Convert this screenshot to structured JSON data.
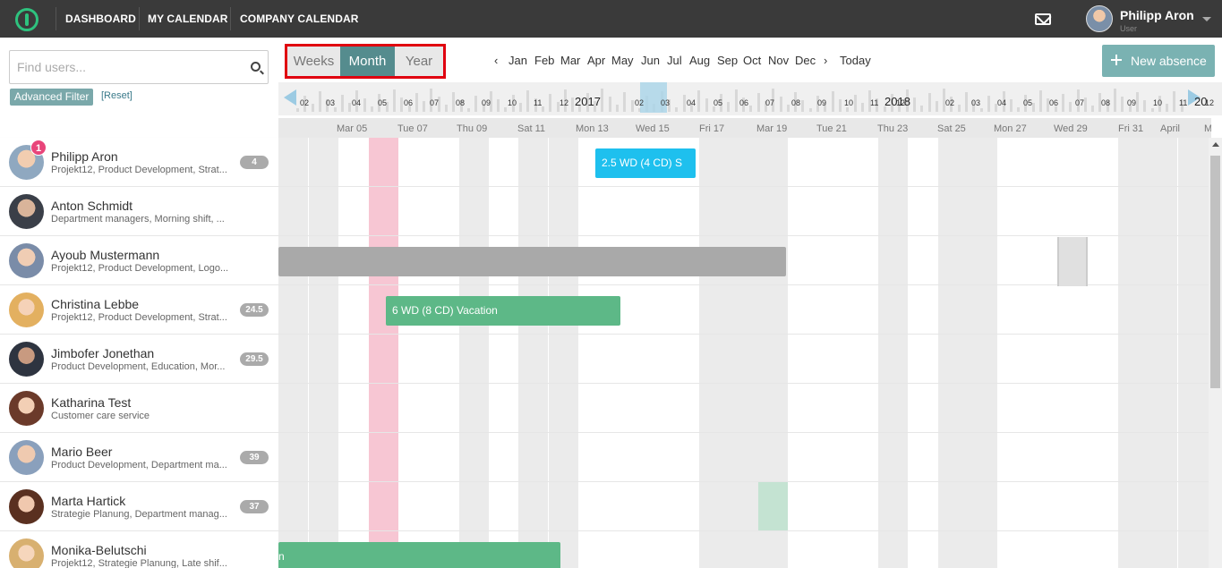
{
  "nav": {
    "items": [
      "DASHBOARD",
      "MY CALENDAR",
      "COMPANY CALENDAR"
    ],
    "user_name": "Philipp Aron",
    "user_role": "User"
  },
  "search": {
    "placeholder": "Find users..."
  },
  "filters": {
    "advanced_label": "Advanced Filter",
    "reset_label": "[Reset]"
  },
  "toolbar": {
    "views": [
      "Weeks",
      "Month",
      "Year"
    ],
    "active_view": "Month",
    "prev": "‹",
    "next": "›",
    "months": [
      "Jan",
      "Feb",
      "Mar",
      "Apr",
      "May",
      "Jun",
      "Jul",
      "Aug",
      "Sep",
      "Oct",
      "Nov",
      "Dec"
    ],
    "today": "Today",
    "new_absence": "New absence"
  },
  "timeline": {
    "years": [
      "2017",
      "2018",
      "20"
    ],
    "labels": [
      "02",
      "03",
      "04",
      "05",
      "06",
      "07",
      "08",
      "09",
      "10",
      "11",
      "12",
      "02",
      "03",
      "04",
      "05",
      "06",
      "07",
      "08",
      "09",
      "10",
      "11",
      "12",
      "02",
      "03",
      "04",
      "05",
      "06",
      "07",
      "08",
      "09",
      "10",
      "11",
      "12"
    ]
  },
  "day_headers": [
    "Mar 05",
    "Tue 07",
    "Thu 09",
    "Sat 11",
    "Mon 13",
    "Wed 15",
    "Fri 17",
    "Mar 19",
    "Tue 21",
    "Thu 23",
    "Sat 25",
    "Mon 27",
    "Wed 29",
    "Fri 31",
    "April",
    "Mo"
  ],
  "users": [
    {
      "name": "Philipp Aron",
      "sub": "Projekt12, Product Development, Strat...",
      "badge": "4",
      "notif": "1"
    },
    {
      "name": "Anton Schmidt",
      "sub": "Department managers, Morning shift, ...",
      "badge": "",
      "notif": ""
    },
    {
      "name": "Ayoub Mustermann",
      "sub": "Projekt12, Product Development, Logo...",
      "badge": "",
      "notif": ""
    },
    {
      "name": "Christina Lebbe",
      "sub": "Projekt12, Product Development, Strat...",
      "badge": "24.5",
      "notif": ""
    },
    {
      "name": "Jimbofer Jonethan",
      "sub": "Product Development, Education, Mor...",
      "badge": "29.5",
      "notif": ""
    },
    {
      "name": "Katharina Test",
      "sub": "Customer care service",
      "badge": "",
      "notif": ""
    },
    {
      "name": "Mario Beer",
      "sub": "Product Development, Department ma...",
      "badge": "39",
      "notif": ""
    },
    {
      "name": "Marta Hartick",
      "sub": "Strategie Planung, Department manag...",
      "badge": "37",
      "notif": ""
    },
    {
      "name": "Monika-Belutschi",
      "sub": "Projekt12, Strategie Planung, Late shif...",
      "badge": "",
      "notif": ""
    }
  ],
  "absences": [
    {
      "label": "2.5 WD (4 CD) S",
      "color": "#1ec0ee"
    },
    {
      "label": "",
      "color": "#a9a9a9"
    },
    {
      "label": "6 WD (8 CD) Vacation",
      "color": "#5db887"
    },
    {
      "label": "n",
      "color": "#5db887"
    }
  ],
  "colors": {
    "accent": "#558c8e",
    "topbar": "#3a3a3a",
    "today": "#f7c6d3",
    "highlight": "#e0000f"
  }
}
